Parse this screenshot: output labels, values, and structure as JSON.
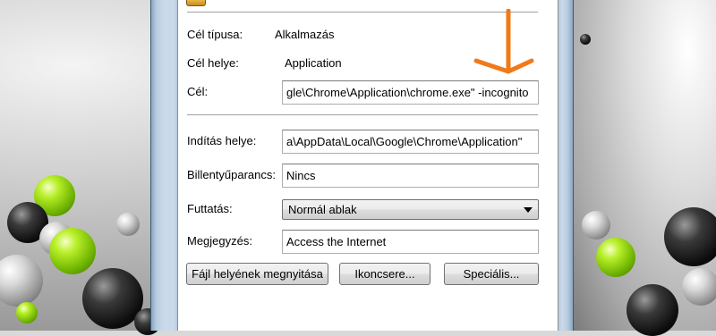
{
  "dialog": {
    "fields": {
      "target_type": {
        "label": "Cél típusa:",
        "value": "Alkalmazás"
      },
      "target_location": {
        "label": "Cél helye:",
        "value": "Application"
      },
      "target": {
        "label": "Cél:",
        "value": "gle\\Chrome\\Application\\chrome.exe\" -incognito"
      },
      "start_in": {
        "label": "Indítás helye:",
        "value": "a\\AppData\\Local\\Google\\Chrome\\Application\""
      },
      "shortcut_key": {
        "label": "Billentyűparancs:",
        "value": "Nincs"
      },
      "run": {
        "label": "Futtatás:",
        "value": "Normál ablak"
      },
      "comment": {
        "label": "Megjegyzés:",
        "value": "Access the Internet"
      }
    },
    "buttons": {
      "open_location": "Fájl helyének megnyitása",
      "change_icon": "Ikoncsere...",
      "advanced": "Speciális..."
    }
  },
  "annotation": {
    "color": "#f07a1a",
    "icon": "down-arrow-icon"
  }
}
